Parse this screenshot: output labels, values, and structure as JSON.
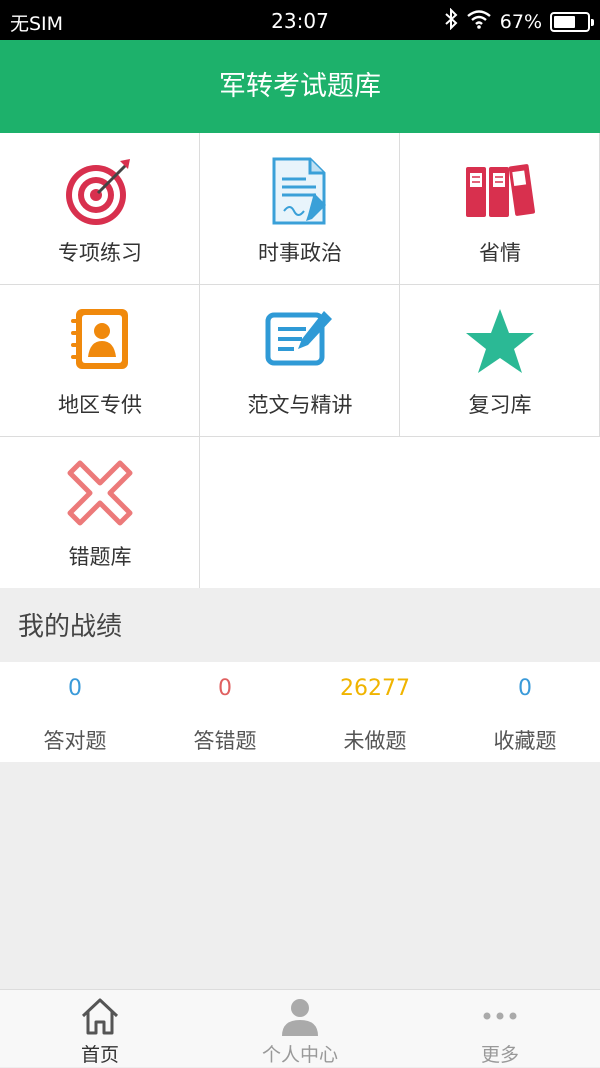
{
  "status_bar": {
    "carrier": "无SIM",
    "time": "23:07",
    "battery_percent": "67%",
    "battery_level": 0.67
  },
  "header": {
    "title": "军转考试题库"
  },
  "menu": [
    {
      "label": "专项练习",
      "icon": "target-icon"
    },
    {
      "label": "时事政治",
      "icon": "document-pen-icon"
    },
    {
      "label": "省情",
      "icon": "binders-icon"
    },
    {
      "label": "地区专供",
      "icon": "contact-book-icon"
    },
    {
      "label": "范文与精讲",
      "icon": "edit-note-icon"
    },
    {
      "label": "复习库",
      "icon": "star-icon"
    },
    {
      "label": "错题库",
      "icon": "cross-icon"
    }
  ],
  "record": {
    "title": "我的战绩",
    "stats": [
      {
        "value": "0",
        "label": "答对题",
        "color": "#3a9ad9"
      },
      {
        "value": "0",
        "label": "答错题",
        "color": "#e06060"
      },
      {
        "value": "26277",
        "label": "未做题",
        "color": "#f0b400"
      },
      {
        "value": "0",
        "label": "收藏题",
        "color": "#3a9ad9"
      }
    ]
  },
  "tabs": [
    {
      "label": "首页",
      "icon": "home-icon",
      "active": true
    },
    {
      "label": "个人中心",
      "icon": "person-icon",
      "active": false
    },
    {
      "label": "更多",
      "icon": "more-icon",
      "active": false
    }
  ],
  "colors": {
    "brand": "#1db16b",
    "active_tab": "#333333",
    "inactive_tab": "#999999"
  }
}
